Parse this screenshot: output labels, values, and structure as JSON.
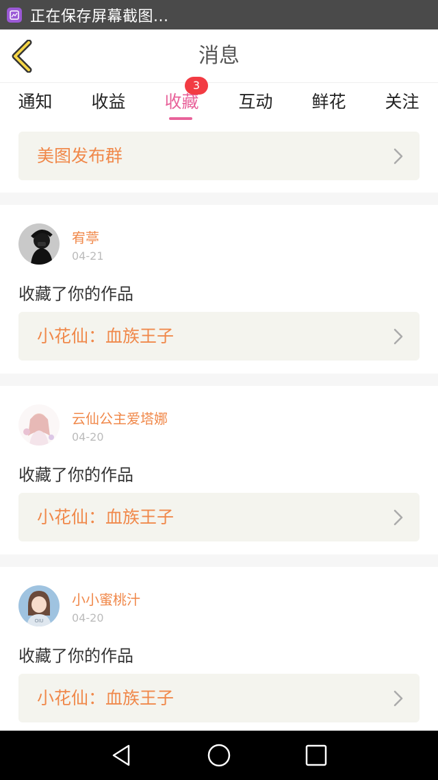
{
  "status_bar": {
    "text": "正在保存屏幕截图...",
    "icon": "screenshot-icon"
  },
  "header": {
    "title": "消息",
    "back_icon": "back-chevron-icon"
  },
  "tabs": [
    {
      "label": "通知",
      "active": false
    },
    {
      "label": "收益",
      "active": false
    },
    {
      "label": "收藏",
      "active": true,
      "badge": "3"
    },
    {
      "label": "互动",
      "active": false
    },
    {
      "label": "鲜花",
      "active": false
    },
    {
      "label": "关注",
      "active": false
    }
  ],
  "group_link": {
    "label": "美图发布群"
  },
  "messages": [
    {
      "username": "宥葶",
      "date": "04-21",
      "action": "收藏了你的作品",
      "work": "小花仙：血族王子"
    },
    {
      "username": "云仙公主爱塔娜",
      "date": "04-20",
      "action": "收藏了你的作品",
      "work": "小花仙：血族王子"
    },
    {
      "username": "小小蜜桃汁",
      "date": "04-20",
      "action": "收藏了你的作品",
      "work": "小花仙：血族王子"
    }
  ],
  "colors": {
    "accent_pink": "#e8629a",
    "orange_text": "#f0884a",
    "badge_red": "#f23b43",
    "card_bg": "#f4f4ee"
  },
  "nav_icons": [
    "back-triangle-icon",
    "home-circle-icon",
    "recents-square-icon"
  ]
}
